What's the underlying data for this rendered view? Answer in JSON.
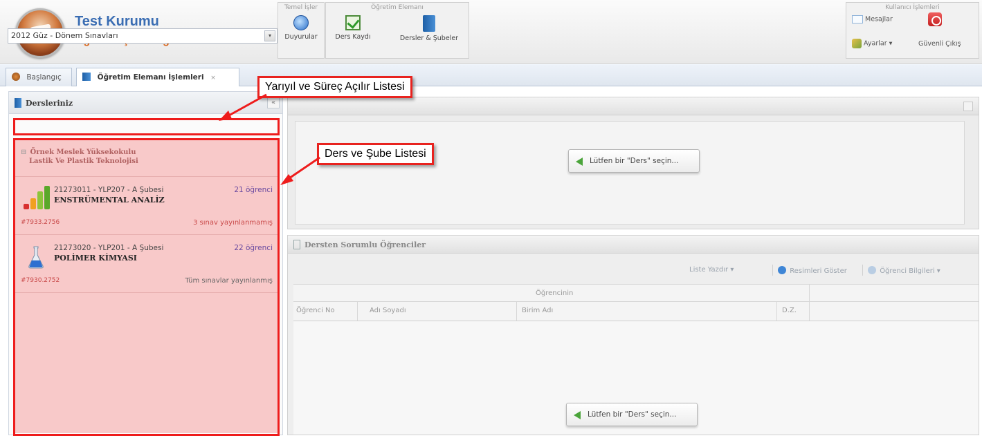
{
  "header": {
    "institution": "Test Kurumu",
    "system_name": "Öğrenci İşleri Bilgi Sistemi Test",
    "groups": [
      {
        "title": "Temel İşler"
      },
      {
        "title": "Öğretim Elemanı"
      },
      {
        "title": "Kullanıcı İşlemleri"
      }
    ],
    "buttons": {
      "announcements": "Duyurular",
      "course_registration": "Ders Kaydı",
      "courses_sections": "Dersler & Şubeler",
      "messages": "Mesajlar",
      "settings": "Ayarlar ▾",
      "logout": "Güvenli Çıkış"
    },
    "icons": {
      "announcements": "globe-icon",
      "course_registration": "check-document-icon",
      "courses_sections": "book-icon",
      "messages": "mail-icon",
      "settings": "wrench-icon",
      "logout": "power-icon"
    }
  },
  "tabs": [
    {
      "label": "Başlangıç"
    },
    {
      "label": "Öğretim Elemanı İşlemleri",
      "close": "×"
    }
  ],
  "left_panel": {
    "title": "Dersleriniz",
    "collapse": "«",
    "term_select": {
      "value": "2012 Güz - Dönem Sınavları",
      "arrow": "▾"
    },
    "group": {
      "toggle": "⊟",
      "line1": "Örnek Meslek Yüksekokulu",
      "line2": "Lastik Ve Plastik Teknolojisi"
    },
    "courses": [
      {
        "code": "21273011 - YLP207 - A Şubesi",
        "name": "ENSTRÜMENTAL ANALİZ",
        "count": "21 öğrenci",
        "id": "#7933.2756",
        "status": "3 sınav yayınlanmamış",
        "icon": "bar-chart-icon"
      },
      {
        "code": "21273020 - YLP201 - A Şubesi",
        "name": "POLİMER KİMYASI",
        "count": "22 öğrenci",
        "id": "#7930.2752",
        "status": "Tüm sınavlar yayınlanmış",
        "icon": "flask-icon"
      }
    ]
  },
  "right_top": {
    "hint": "Lütfen bir \"Ders\" seçin..."
  },
  "right_bottom": {
    "title": "Dersten Sorumlu Öğrenciler",
    "toolbar": {
      "print_list": "Liste Yazdır ▾",
      "show_pictures": "Resimleri Göster",
      "student_info": "Öğrenci Bilgileri ▾"
    },
    "group_header": "Öğrencinin",
    "columns": [
      "Öğrenci No",
      "Adı Soyadı",
      "Birim Adı",
      "D.Z."
    ],
    "hint": "Lütfen bir \"Ders\" seçin..."
  },
  "annotations": {
    "term_callout": "Yarıyıl ve Süreç Açılır Listesi",
    "course_callout": "Ders ve Şube Listesi",
    "color": "#ee1c1c"
  }
}
